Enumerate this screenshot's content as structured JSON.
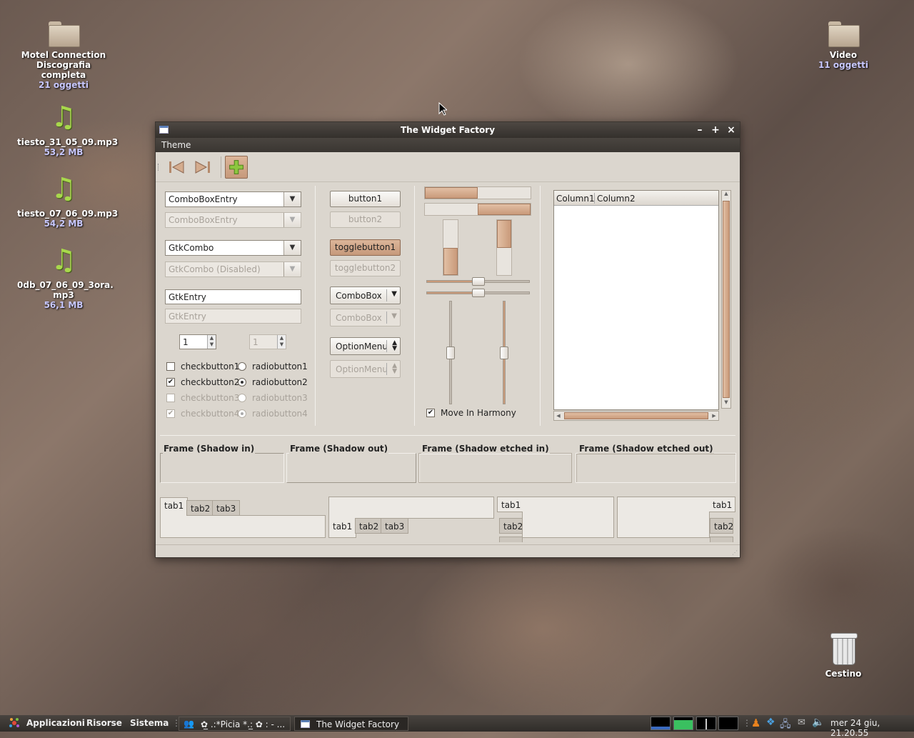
{
  "desktop": {
    "icons": [
      {
        "name": "Motel Connection Discografia completa",
        "line1": "Motel Connection",
        "line2": "Discografia completa",
        "sub": "21 oggetti",
        "type": "folder"
      },
      {
        "name": "tiesto_31_05_09.mp3",
        "sub": "53,2 MB",
        "type": "music"
      },
      {
        "name": "tiesto_07_06_09.mp3",
        "sub": "54,2 MB",
        "type": "music"
      },
      {
        "line1": "0db_07_06_09_3ora.",
        "line2": "mp3",
        "sub": "56,1 MB",
        "type": "music"
      },
      {
        "name": "Video",
        "sub": "11 oggetti",
        "type": "folder"
      },
      {
        "name": "Cestino",
        "type": "trash"
      }
    ]
  },
  "window": {
    "title": "The Widget Factory",
    "menu": {
      "theme": "Theme"
    },
    "toolbar": {
      "back": "back",
      "forward": "forward",
      "add": "add"
    },
    "col1": {
      "combo_entry": "ComboBoxEntry",
      "combo_entry_dis": "ComboBoxEntry",
      "gtkcombo": "GtkCombo",
      "gtkcombo_dis": "GtkCombo (Disabled)",
      "entry": "GtkEntry",
      "entry_dis": "GtkEntry",
      "spin": "1",
      "spin_dis": "1",
      "checks": [
        "checkbutton1",
        "checkbutton2",
        "checkbutton3",
        "checkbutton4"
      ],
      "radios": [
        "radiobutton1",
        "radiobutton2",
        "radiobutton3",
        "radiobutton4"
      ],
      "check_states": [
        false,
        true,
        false,
        true
      ],
      "radio_states": [
        false,
        true,
        false,
        true
      ]
    },
    "col2": {
      "button1": "button1",
      "button2": "button2",
      "toggle1": "togglebutton1",
      "toggle2": "togglebutton2",
      "combobox": "ComboBox",
      "combobox_dis": "ComboBox",
      "optionmenu": "OptionMenu",
      "optionmenu_dis": "OptionMenu"
    },
    "col3": {
      "progress_h1": 0.5,
      "progress_h2": 0.5,
      "progress_v1": 0.5,
      "progress_v2": 0.5,
      "scale_h1": 0.5,
      "scale_h2": 0.5,
      "scale_v1": 0.5,
      "scale_v2": 0.5,
      "harmony": "Move In Harmony",
      "harmony_checked": true
    },
    "tree": {
      "col1": "Column1",
      "col2": "Column2"
    },
    "frames": [
      "Frame (Shadow in)",
      "Frame (Shadow out)",
      "Frame (Shadow etched in)",
      "Frame (Shadow etched out)"
    ],
    "tabs": {
      "t1": "tab1",
      "t2": "tab2",
      "t3": "tab3"
    }
  },
  "panel": {
    "applications": "Applicazioni",
    "places": "Risorse",
    "system": "Sistema",
    "task1": "✿̲ .:*Picia *.:̲ ✿ : - ...",
    "task2": "The Widget Factory",
    "clock": "mer 24 giu, 21.20.55"
  }
}
